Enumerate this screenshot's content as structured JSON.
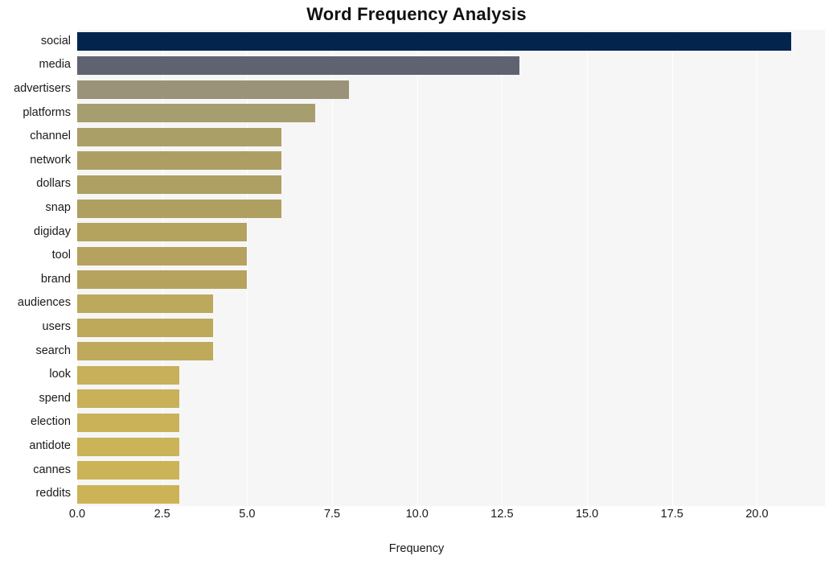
{
  "chart_data": {
    "type": "bar",
    "orientation": "horizontal",
    "title": "Word Frequency Analysis",
    "xlabel": "Frequency",
    "ylabel": "",
    "categories": [
      "social",
      "media",
      "advertisers",
      "platforms",
      "channel",
      "network",
      "dollars",
      "snap",
      "digiday",
      "tool",
      "brand",
      "audiences",
      "users",
      "search",
      "look",
      "spend",
      "election",
      "antidote",
      "cannes",
      "reddits"
    ],
    "values": [
      21,
      13,
      8,
      7,
      6,
      6,
      6,
      6,
      5,
      5,
      5,
      4,
      4,
      4,
      3,
      3,
      3,
      3,
      3,
      3
    ],
    "bar_colors": [
      "#03244d",
      "#5f6371",
      "#9a9379",
      "#a79e70",
      "#ab9f68",
      "#ad9f64",
      "#ae9f62",
      "#af9f61",
      "#b4a25f",
      "#b5a25e",
      "#b6a35d",
      "#bda95c",
      "#bea95b",
      "#bfaa5b",
      "#c7b059",
      "#c8b158",
      "#c9b258",
      "#cab358",
      "#cbb357",
      "#ccb456"
    ],
    "xticks": [
      "0.0",
      "2.5",
      "5.0",
      "7.5",
      "10.0",
      "12.5",
      "15.0",
      "17.5",
      "20.0"
    ],
    "xtick_values": [
      0,
      2.5,
      5,
      7.5,
      10,
      12.5,
      15,
      17.5,
      20
    ],
    "xlim": [
      0,
      22
    ],
    "grid": true,
    "grid_color": "#ffffff",
    "plot_background": "#f6f6f6",
    "figure_background": "#ffffff",
    "legend": null
  }
}
